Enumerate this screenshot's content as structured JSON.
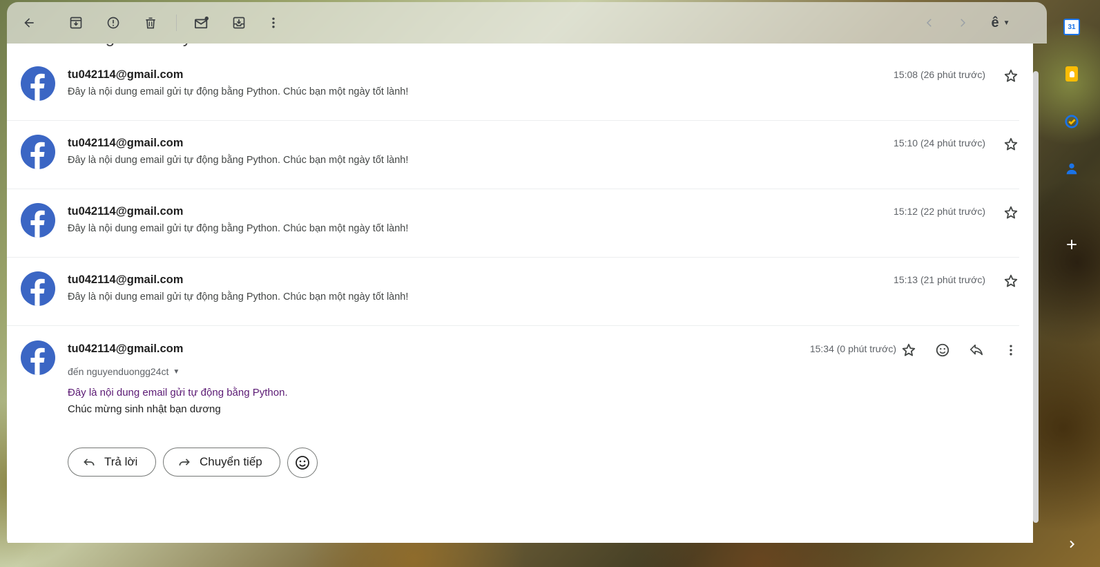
{
  "toolbar": {
    "back_icon": "arrow-left-icon",
    "archive_icon": "archive-icon",
    "spam_icon": "report-spam-icon",
    "delete_icon": "trash-icon",
    "unread_icon": "mark-unread-icon",
    "move_icon": "move-to-icon",
    "more_icon": "more-vert-icon",
    "prev_icon": "chevron-left-icon",
    "next_icon": "chevron-right-icon",
    "input_tools_label": "ê"
  },
  "thread": {
    "subject_partial": "Thông báo từ Python"
  },
  "messages": [
    {
      "sender": "tu042114@gmail.com",
      "snippet": "Đây là nội dung email gửi tự động bằng Python. Chúc bạn một ngày tốt lành!",
      "time": "15:08 (26 phút trước)"
    },
    {
      "sender": "tu042114@gmail.com",
      "snippet": "Đây là nội dung email gửi tự động bằng Python. Chúc bạn một ngày tốt lành!",
      "time": "15:10 (24 phút trước)"
    },
    {
      "sender": "tu042114@gmail.com",
      "snippet": "Đây là nội dung email gửi tự động bằng Python. Chúc bạn một ngày tốt lành!",
      "time": "15:12 (22 phút trước)"
    },
    {
      "sender": "tu042114@gmail.com",
      "snippet": "Đây là nội dung email gửi tự động bằng Python. Chúc bạn một ngày tốt lành!",
      "time": "15:13 (21 phút trước)"
    }
  ],
  "open_message": {
    "sender": "tu042114@gmail.com",
    "recipient": "đến nguyenduongg24ct",
    "time": "15:34 (0 phút trước)",
    "body_line1": "Đây là nội dung email gửi tự động bằng Python.",
    "body_line2": "Chúc mừng sinh nhật bạn dương",
    "reply_label": "Trả lời",
    "forward_label": "Chuyển tiếp"
  },
  "side_panel": {
    "calendar_label": "31",
    "colors": {
      "calendar": "#1a73e8",
      "keep": "#fbbc04",
      "tasks": "#1a73e8",
      "contacts": "#1a73e8"
    }
  },
  "colors": {
    "avatar": "#3b66c4",
    "body_link": "#5b1a74"
  }
}
